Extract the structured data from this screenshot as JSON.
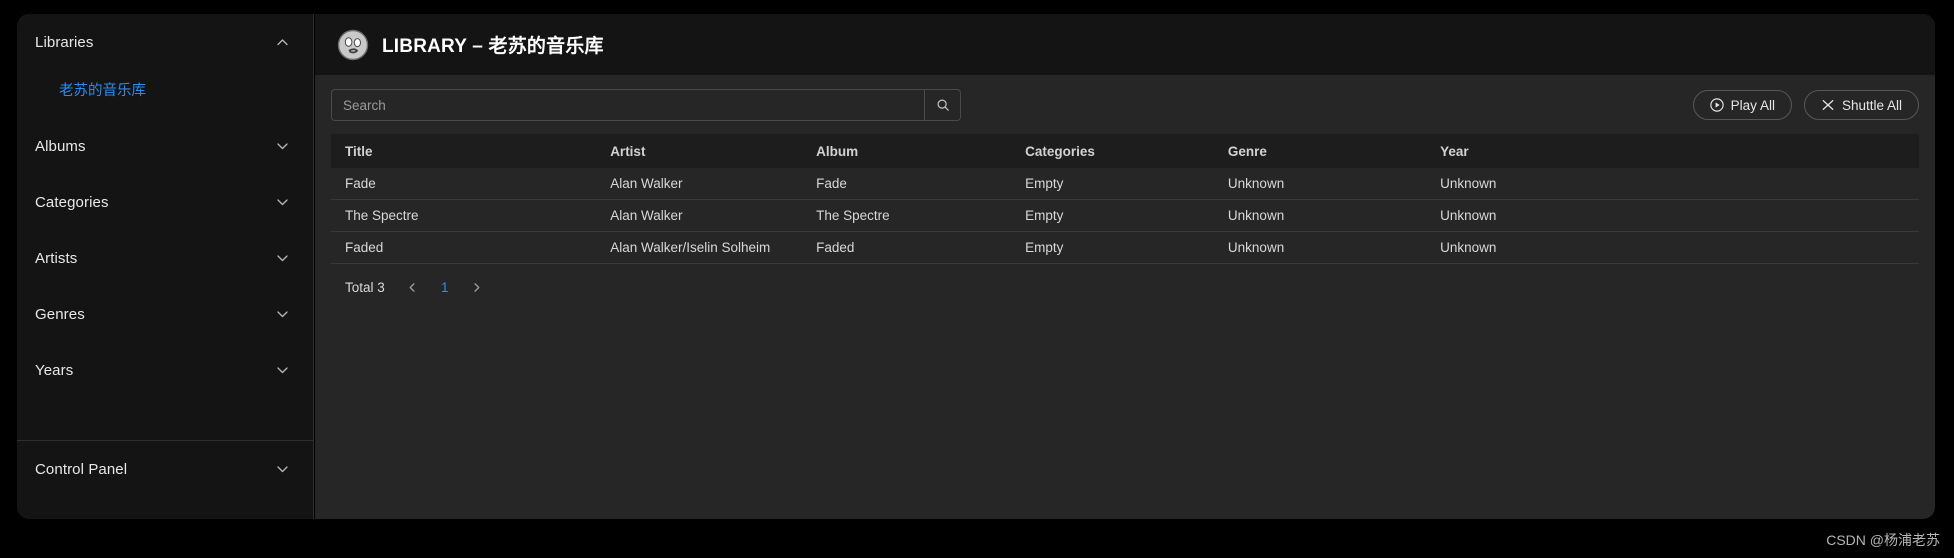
{
  "sidebar": {
    "groups": [
      {
        "label": "Libraries",
        "icon": "chevron-up-icon",
        "expanded": true,
        "children": [
          {
            "label": "老苏的音乐库",
            "active": true
          }
        ]
      },
      {
        "label": "Albums",
        "icon": "chevron-down-icon",
        "expanded": false,
        "children": []
      },
      {
        "label": "Categories",
        "icon": "chevron-down-icon",
        "expanded": false,
        "children": []
      },
      {
        "label": "Artists",
        "icon": "chevron-down-icon",
        "expanded": false,
        "children": []
      },
      {
        "label": "Genres",
        "icon": "chevron-down-icon",
        "expanded": false,
        "children": []
      },
      {
        "label": "Years",
        "icon": "chevron-down-icon",
        "expanded": false,
        "children": []
      }
    ],
    "footer": [
      {
        "label": "Control Panel",
        "icon": "chevron-down-icon",
        "expanded": false,
        "children": []
      }
    ]
  },
  "header": {
    "logo_icon": "face-logo-icon",
    "title": "LIBRARY – 老苏的音乐库"
  },
  "toolbar": {
    "search": {
      "placeholder": "Search",
      "value": "",
      "button_icon": "search-icon"
    },
    "play_all_label": "Play All",
    "play_all_icon": "play-circle-icon",
    "shuttle_all_label": "Shuttle All",
    "shuttle_all_icon": "shuffle-icon"
  },
  "table": {
    "columns": [
      "Title",
      "Artist",
      "Album",
      "Categories",
      "Genre",
      "Year"
    ],
    "rows": [
      {
        "title": "Fade",
        "artist": "Alan Walker",
        "album": "Fade",
        "categories": "Empty",
        "genre": "Unknown",
        "year": "Unknown"
      },
      {
        "title": "The Spectre",
        "artist": "Alan Walker",
        "album": "The Spectre",
        "categories": "Empty",
        "genre": "Unknown",
        "year": "Unknown"
      },
      {
        "title": "Faded",
        "artist": "Alan Walker/Iselin Solheim",
        "album": "Faded",
        "categories": "Empty",
        "genre": "Unknown",
        "year": "Unknown"
      }
    ]
  },
  "pagination": {
    "total_label": "Total 3",
    "prev_icon": "chevron-left-icon",
    "next_icon": "chevron-right-icon",
    "current_page": "1"
  },
  "watermark": "CSDN @杨浦老苏",
  "colors": {
    "accent": "#2d8cf0",
    "page_background": "#000000",
    "sidebar_background": "#141414",
    "panel_background": "#262626",
    "header_background": "#141414",
    "table_header_background": "#1d1d1d",
    "row_border": "#3a3a3a",
    "text_primary": "#e8e8e8",
    "text_muted": "#9a9a9a"
  }
}
